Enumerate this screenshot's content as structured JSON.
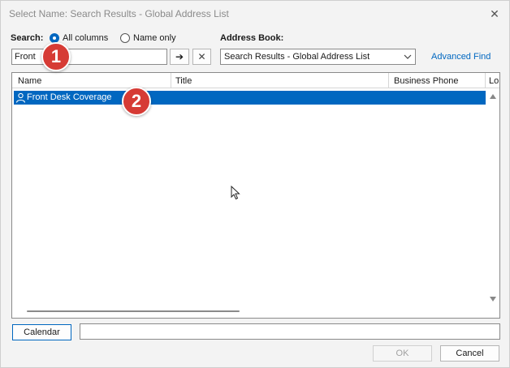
{
  "window": {
    "title": "Select Name: Search Results - Global Address List",
    "close_glyph": "✕"
  },
  "search": {
    "label": "Search:",
    "option_all": "All columns",
    "option_name": "Name only",
    "selected_option": "All columns",
    "value": "Front",
    "go_glyph": "➔",
    "clear_glyph": "✕"
  },
  "address_book": {
    "label": "Address Book:",
    "selected": "Search Results - Global Address List",
    "advanced_find": "Advanced Find"
  },
  "list": {
    "columns": [
      "Name",
      "Title",
      "Business Phone",
      "Lo"
    ],
    "rows": [
      {
        "name": "Front Desk Coverage",
        "selected": true
      }
    ]
  },
  "footer": {
    "calendar_label": "Calendar",
    "ok_label": "OK",
    "cancel_label": "Cancel"
  },
  "annotations": {
    "badge_1": "1",
    "badge_2": "2"
  },
  "colors": {
    "accent": "#0067c0",
    "badge": "#d63b35",
    "selection": "#0067c0"
  }
}
